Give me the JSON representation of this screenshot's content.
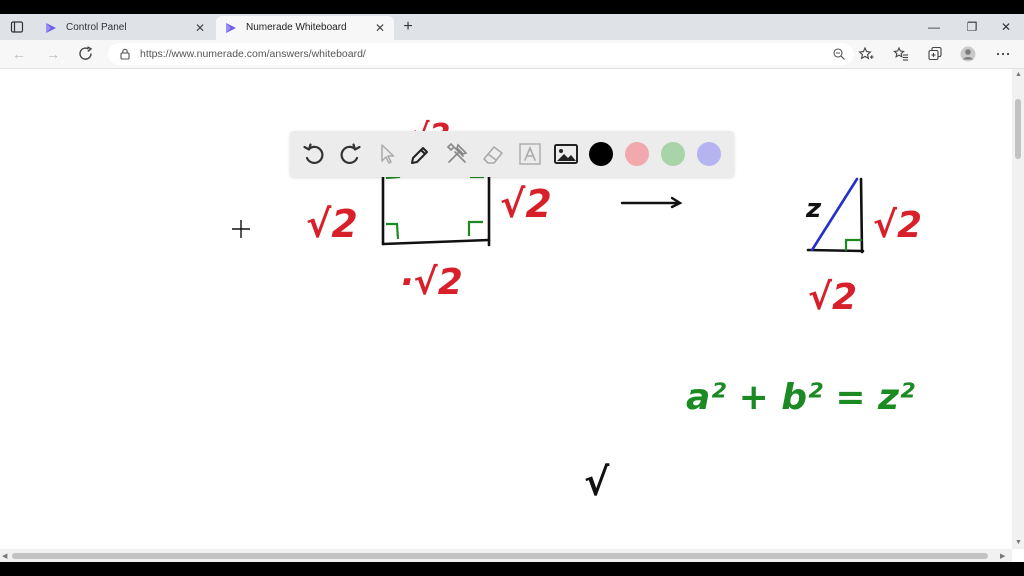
{
  "browser": {
    "tabs": [
      {
        "label": "Control Panel",
        "active": false
      },
      {
        "label": "Numerade Whiteboard",
        "active": true
      }
    ],
    "close_glyph": "✕",
    "newtab_glyph": "+",
    "url": "https://www.numerade.com/answers/whiteboard/",
    "window_controls": {
      "minimize": "—",
      "restore": "❐",
      "close": "✕"
    },
    "nav": {
      "back": "←",
      "forward": "→"
    }
  },
  "whiteboard": {
    "tools": [
      "undo-icon",
      "redo-icon",
      "pointer-icon",
      "pen-icon",
      "tools-icon",
      "eraser-icon",
      "text-icon",
      "image-icon"
    ],
    "colors": [
      "#000000",
      "#f2a9ad",
      "#a9d3a9",
      "#b4b4f0"
    ],
    "ink_colors": {
      "black": "#111111",
      "red": "#d8202a",
      "green": "#1c8a22",
      "blue": "#2530c8"
    },
    "handwriting": {
      "top_label": "-√2",
      "left_label": "√2",
      "right_label": "√2",
      "bottom_label": "·√2",
      "triangle_z": "z",
      "triangle_right_label": "√2",
      "triangle_bottom_label": "√2",
      "equation": "a² + b² = z²",
      "stray_mark": "√"
    }
  }
}
